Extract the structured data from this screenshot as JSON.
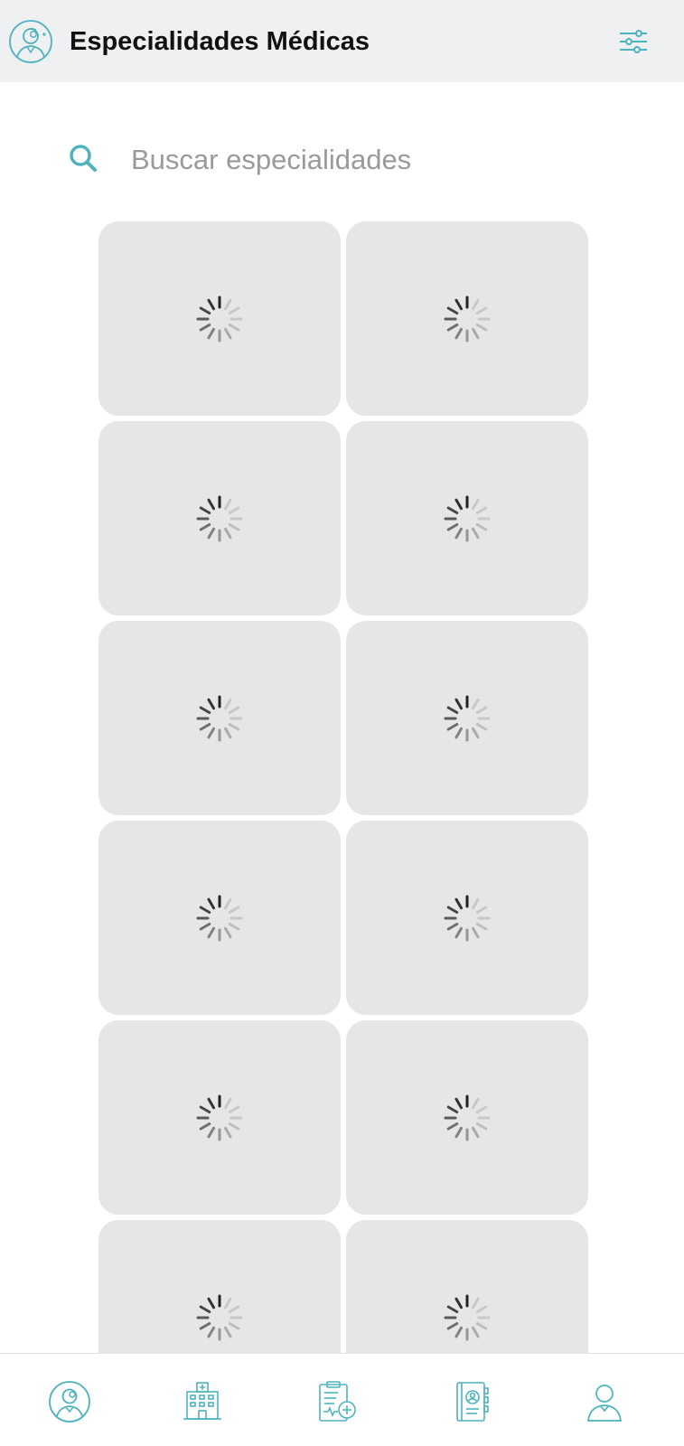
{
  "header": {
    "title": "Especialidades Médicas",
    "avatar_icon": "doctor-avatar-icon",
    "filter_icon": "sliders-filter-icon"
  },
  "search": {
    "placeholder": "Buscar especialidades",
    "value": "",
    "icon": "search-icon"
  },
  "grid": {
    "cards": [
      {
        "state": "loading"
      },
      {
        "state": "loading"
      },
      {
        "state": "loading"
      },
      {
        "state": "loading"
      },
      {
        "state": "loading"
      },
      {
        "state": "loading"
      },
      {
        "state": "loading"
      },
      {
        "state": "loading"
      },
      {
        "state": "loading"
      },
      {
        "state": "loading"
      },
      {
        "state": "loading"
      },
      {
        "state": "loading"
      }
    ]
  },
  "bottom_nav": {
    "items": [
      {
        "icon": "doctor-icon"
      },
      {
        "icon": "hospital-icon"
      },
      {
        "icon": "medical-report-icon"
      },
      {
        "icon": "contacts-book-icon"
      },
      {
        "icon": "user-profile-icon"
      }
    ]
  },
  "colors": {
    "accent": "#4fb3bf",
    "header_bg": "#eef0f2",
    "card_bg": "#e6e6e6",
    "title": "#111111",
    "placeholder": "#9a9a9a"
  }
}
